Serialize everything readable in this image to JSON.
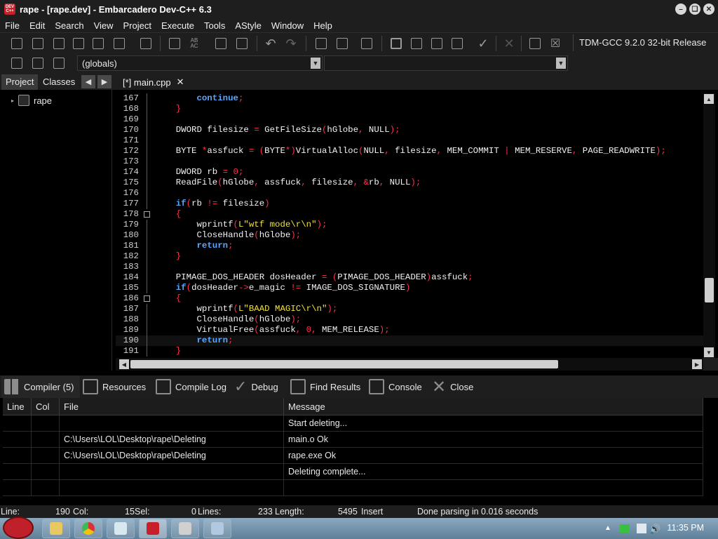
{
  "window": {
    "title": "rape - [rape.dev] - Embarcadero Dev-C++ 6.3",
    "app_icon_text": "DEV C++"
  },
  "menu": [
    "File",
    "Edit",
    "Search",
    "View",
    "Project",
    "Execute",
    "Tools",
    "AStyle",
    "Window",
    "Help"
  ],
  "toolbar": {
    "compiler_select": "TDM-GCC 9.2.0 32-bit Release"
  },
  "toolbar2": {
    "scope_combo": "(globals)",
    "member_combo": ""
  },
  "left_panel": {
    "tabs": [
      "Project",
      "Classes"
    ],
    "active_tab": "Project",
    "tree_root": "rape"
  },
  "editor": {
    "tab_label": "[*] main.cpp",
    "lines": [
      {
        "n": "167",
        "code": "        continue;"
      },
      {
        "n": "168",
        "code": "    }"
      },
      {
        "n": "169",
        "code": ""
      },
      {
        "n": "170",
        "code": "    DWORD filesize = GetFileSize(hGlobe, NULL);"
      },
      {
        "n": "171",
        "code": ""
      },
      {
        "n": "172",
        "code": "    BYTE *assfuck = (BYTE*)VirtualAlloc(NULL, filesize, MEM_COMMIT | MEM_RESERVE, PAGE_READWRITE);"
      },
      {
        "n": "173",
        "code": ""
      },
      {
        "n": "174",
        "code": "    DWORD rb = 0;"
      },
      {
        "n": "175",
        "code": "    ReadFile(hGlobe, assfuck, filesize, &rb, NULL);"
      },
      {
        "n": "176",
        "code": ""
      },
      {
        "n": "177",
        "code": "    if(rb != filesize)"
      },
      {
        "n": "178",
        "code": "    {"
      },
      {
        "n": "179",
        "code": "        wprintf(L\"wtf mode\\r\\n\");"
      },
      {
        "n": "180",
        "code": "        CloseHandle(hGlobe);"
      },
      {
        "n": "181",
        "code": "        return;"
      },
      {
        "n": "182",
        "code": "    }"
      },
      {
        "n": "183",
        "code": ""
      },
      {
        "n": "184",
        "code": "    PIMAGE_DOS_HEADER dosHeader = (PIMAGE_DOS_HEADER)assfuck;"
      },
      {
        "n": "185",
        "code": "    if(dosHeader->e_magic != IMAGE_DOS_SIGNATURE)"
      },
      {
        "n": "186",
        "code": "    {"
      },
      {
        "n": "187",
        "code": "        wprintf(L\"BAAD MAGIC\\r\\n\");"
      },
      {
        "n": "188",
        "code": "        CloseHandle(hGlobe);"
      },
      {
        "n": "189",
        "code": "        VirtualFree(assfuck, 0, MEM_RELEASE);"
      },
      {
        "n": "190",
        "code": "        return;"
      },
      {
        "n": "191",
        "code": "    }"
      }
    ]
  },
  "bottom_tabs": [
    {
      "label": "Compiler (5)",
      "icon": "grid-icon"
    },
    {
      "label": "Resources",
      "icon": "resources-icon"
    },
    {
      "label": "Compile Log",
      "icon": "chart-icon"
    },
    {
      "label": "Debug",
      "icon": "check-icon"
    },
    {
      "label": "Find Results",
      "icon": "find-icon"
    },
    {
      "label": "Console",
      "icon": "console-icon"
    },
    {
      "label": "Close",
      "icon": "close-icon"
    }
  ],
  "messages": {
    "headers": [
      "Line",
      "Col",
      "File",
      "Message"
    ],
    "rows": [
      [
        "",
        "",
        "",
        "Start deleting..."
      ],
      [
        "",
        "",
        "C:\\Users\\LOL\\Desktop\\rape\\Deleting",
        "main.o Ok"
      ],
      [
        "",
        "",
        "C:\\Users\\LOL\\Desktop\\rape\\Deleting",
        "rape.exe Ok"
      ],
      [
        "",
        "",
        "",
        "Deleting complete..."
      ],
      [
        "",
        "",
        "",
        ""
      ]
    ]
  },
  "status": {
    "line_label": "Line:",
    "line_val": "190",
    "col_label": "Col:",
    "col_val": "15",
    "sel_label": "Sel:",
    "sel_val": "0",
    "lines_label": "Lines:",
    "lines_val": "233",
    "length_label": "Length:",
    "length_val": "5495",
    "mode": "Insert",
    "parse": "Done parsing in 0.016 seconds"
  },
  "taskbar": {
    "clock": "11:35 PM"
  }
}
